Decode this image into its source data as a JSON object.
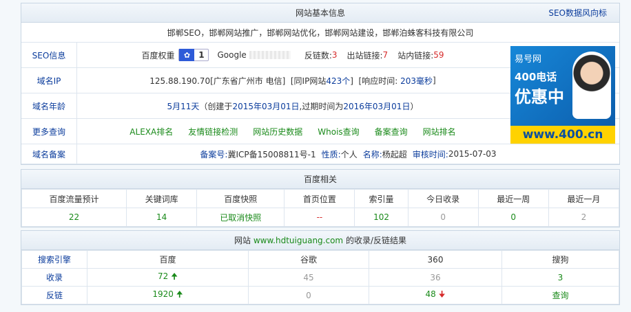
{
  "basic": {
    "title": "网站基本信息",
    "seo_link": "SEO数据风向标",
    "description": "邯郸SEO，邯郸网站推广，邯郸网站优化，邯郸网站建设，邯郸泊蛛客科技有限公司",
    "seo_info": {
      "label": "SEO信息",
      "baidu_weight_label": "百度权重",
      "baidu_weight_value": "1",
      "google_label": "Google",
      "backlinks_label": "反链数:",
      "backlinks_value": "3",
      "outlinks_label": "出站链接:",
      "outlinks_value": "7",
      "inlinks_label": "站内链接:",
      "inlinks_value": "59"
    },
    "ip": {
      "label": "域名IP",
      "text1": "125.88.190.70[广东省广州市 电信]  [同IP网站",
      "same_ip_count": "423个",
      "text2": "]  [响应时间: ",
      "response": "203毫秒",
      "text3": "]"
    },
    "age": {
      "label": "域名年龄",
      "age": "5月11天",
      "text1": "（创建于",
      "created": "2015年03月01日",
      "text2": ",过期时间为",
      "expires": "2016年03月01日",
      "text3": "）"
    },
    "more": {
      "label": "更多查询",
      "links": [
        "ALEXA排名",
        "友情链接检测",
        "网站历史数据",
        "Whois查询",
        "备案查询",
        "网站排名"
      ]
    },
    "icp": {
      "label": "域名备案",
      "no_label": "备案号:",
      "no_value": "冀ICP备15008811号-1",
      "nature_label": "性质:",
      "nature_value": "个人",
      "name_label": "名称:",
      "name_value": "杨起超",
      "review_label": "审核时间:",
      "review_value": "2015-07-03"
    },
    "ad": {
      "brand": "易号网",
      "phone": "400电话",
      "promo": "优惠中",
      "url": "www.400.cn"
    }
  },
  "baidu": {
    "title": "百度相关",
    "headers": [
      "百度流量预计",
      "关键词库",
      "百度快照",
      "首页位置",
      "索引量",
      "今日收录",
      "最近一周",
      "最近一月"
    ],
    "values": [
      "22",
      "14",
      "已取消快照",
      "--",
      "102",
      "0",
      "0",
      "2"
    ]
  },
  "results": {
    "title_prefix": "网站",
    "domain": "www.hdtuiguang.com",
    "title_suffix": "的收录/反链结果",
    "headers": [
      "搜索引擎",
      "百度",
      "谷歌",
      "360",
      "搜狗"
    ],
    "rows": [
      {
        "label": "收录",
        "values": [
          "72",
          "45",
          "36",
          "3"
        ]
      },
      {
        "label": "反链",
        "values": [
          "1920",
          "0",
          "48",
          "查询"
        ]
      }
    ]
  },
  "colors": {
    "link_blue": "#0b3c9c",
    "green": "#1a8a1a",
    "red": "#d62b2b",
    "gray": "#999999"
  }
}
